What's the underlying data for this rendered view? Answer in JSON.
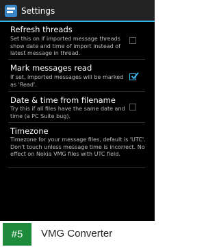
{
  "action_bar": {
    "title": "Settings",
    "icon": "app-icon"
  },
  "settings": [
    {
      "heading": "Refresh threads",
      "summary": "Set this on if imported message threads show date and time of import instead of latest message in thread.",
      "checked": false
    },
    {
      "heading": "Mark messages read",
      "summary": "If set, imported messages will be marked as 'Read'.",
      "checked": true
    },
    {
      "heading": "Date & time from filename",
      "summary": "Try this if all files have the same date and time (a PC Suite bug).",
      "checked": false
    },
    {
      "heading": "Timezone",
      "summary": "Timezone for your message files, default is 'UTC'. Don't touch unless message time is incorrect. No effect on Nokia VMG files with UTC field."
    }
  ],
  "footer": {
    "rank": "#5",
    "app_name": "VMG Converter"
  },
  "colors": {
    "accent": "#33b5e5",
    "action_bar": "#232323",
    "badge": "#1e8a3c"
  }
}
